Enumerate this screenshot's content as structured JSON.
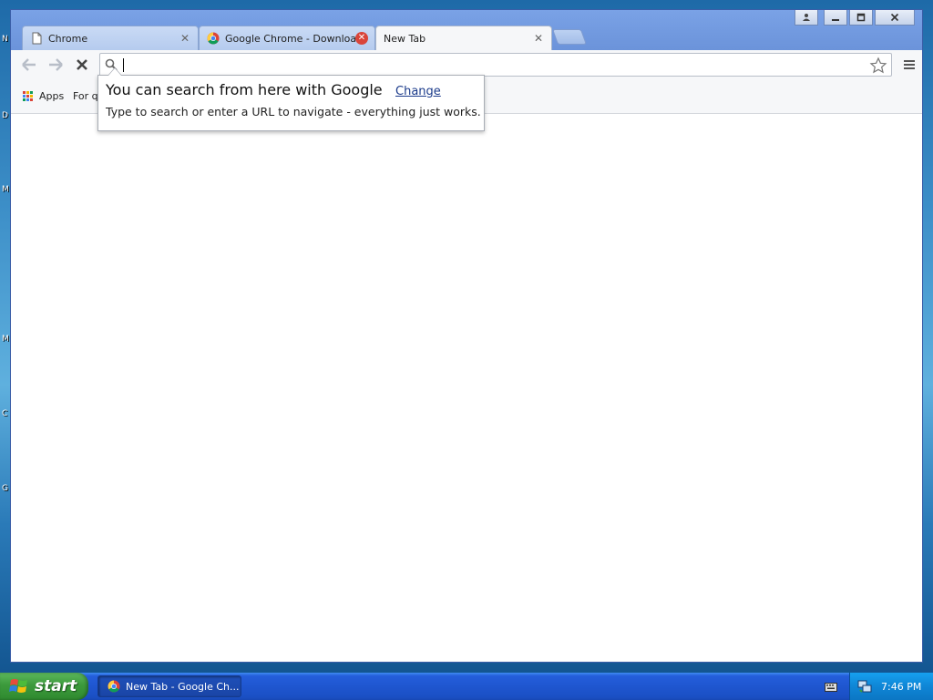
{
  "desktop": {
    "side_letters": [
      "N",
      "D",
      "M",
      "M",
      "C",
      "G"
    ]
  },
  "tabs": [
    {
      "title": "Chrome",
      "icon": "page-icon",
      "close": "✕"
    },
    {
      "title": "Google Chrome - Download f",
      "icon": "chrome-icon",
      "close": "✕"
    },
    {
      "title": "New Tab",
      "icon": "",
      "close": "✕"
    }
  ],
  "window_controls": {
    "user": "👤",
    "minimize": "—",
    "maximize": "□",
    "close": "✕"
  },
  "toolbar": {
    "back": "←",
    "forward": "→",
    "stop": "✕",
    "omnibox_value": "",
    "omnibox_placeholder": ""
  },
  "bookmarks": {
    "apps_label": "Apps",
    "items": [
      "For qu"
    ]
  },
  "bubble": {
    "title": "You can search from here with Google",
    "link": "Change",
    "body": "Type to search or enter a URL to navigate - everything just works."
  },
  "taskbar": {
    "start_label": "start",
    "task_title": "New Tab - Google Ch...",
    "clock": "7:46 PM"
  },
  "colors": {
    "accent_blue": "#245edb",
    "start_green": "#3c9a3c",
    "chrome_frame": "#6f97de"
  }
}
